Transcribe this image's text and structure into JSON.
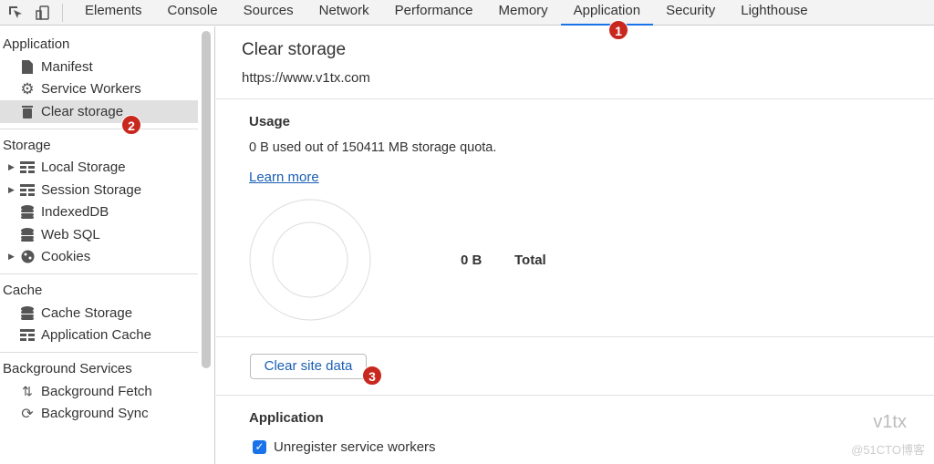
{
  "tabs": [
    "Elements",
    "Console",
    "Sources",
    "Network",
    "Performance",
    "Memory",
    "Application",
    "Security",
    "Lighthouse"
  ],
  "active_tab": "Application",
  "sidebar": {
    "sections": [
      {
        "title": "Application",
        "items": [
          {
            "label": "Manifest",
            "icon": "file-icon"
          },
          {
            "label": "Service Workers",
            "icon": "gear-icon"
          },
          {
            "label": "Clear storage",
            "icon": "trash-icon",
            "selected": true
          }
        ]
      },
      {
        "title": "Storage",
        "items": [
          {
            "label": "Local Storage",
            "icon": "grid-icon",
            "expandable": true
          },
          {
            "label": "Session Storage",
            "icon": "grid-icon",
            "expandable": true
          },
          {
            "label": "IndexedDB",
            "icon": "database-icon"
          },
          {
            "label": "Web SQL",
            "icon": "database-icon"
          },
          {
            "label": "Cookies",
            "icon": "cookie-icon",
            "expandable": true
          }
        ]
      },
      {
        "title": "Cache",
        "items": [
          {
            "label": "Cache Storage",
            "icon": "database-icon"
          },
          {
            "label": "Application Cache",
            "icon": "grid-icon"
          }
        ]
      },
      {
        "title": "Background Services",
        "items": [
          {
            "label": "Background Fetch",
            "icon": "arrows-updown-icon"
          },
          {
            "label": "Background Sync",
            "icon": "sync-icon"
          }
        ]
      }
    ]
  },
  "main": {
    "title": "Clear storage",
    "origin": "https://www.v1tx.com",
    "usage_title": "Usage",
    "usage_text": "0 B used out of 150411 MB storage quota.",
    "learn_more": "Learn more",
    "total_value": "0 B",
    "total_label": "Total",
    "clear_button": "Clear site data",
    "app_section": "Application",
    "checkbox_label": "Unregister service workers",
    "checkbox_checked": true
  },
  "badges": [
    "1",
    "2",
    "3"
  ],
  "watermark": {
    "brand": "v1tx",
    "site": "@51CTO博客"
  }
}
